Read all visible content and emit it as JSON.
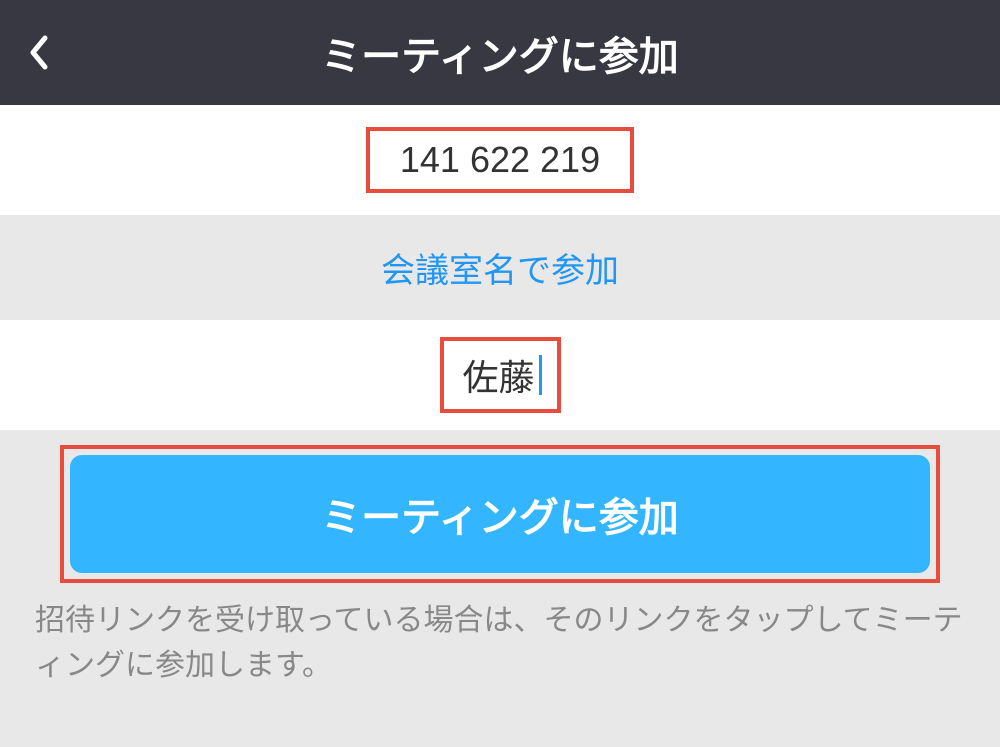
{
  "header": {
    "title": "ミーティングに参加"
  },
  "meetingId": {
    "value": "141 622 219"
  },
  "joinByNameLink": {
    "label": "会議室名で参加"
  },
  "name": {
    "value": "佐藤"
  },
  "joinButton": {
    "label": "ミーティングに参加"
  },
  "helpText": {
    "content": "招待リンクを受け取っている場合は、そのリンクをタップしてミーティングに参加します。"
  }
}
